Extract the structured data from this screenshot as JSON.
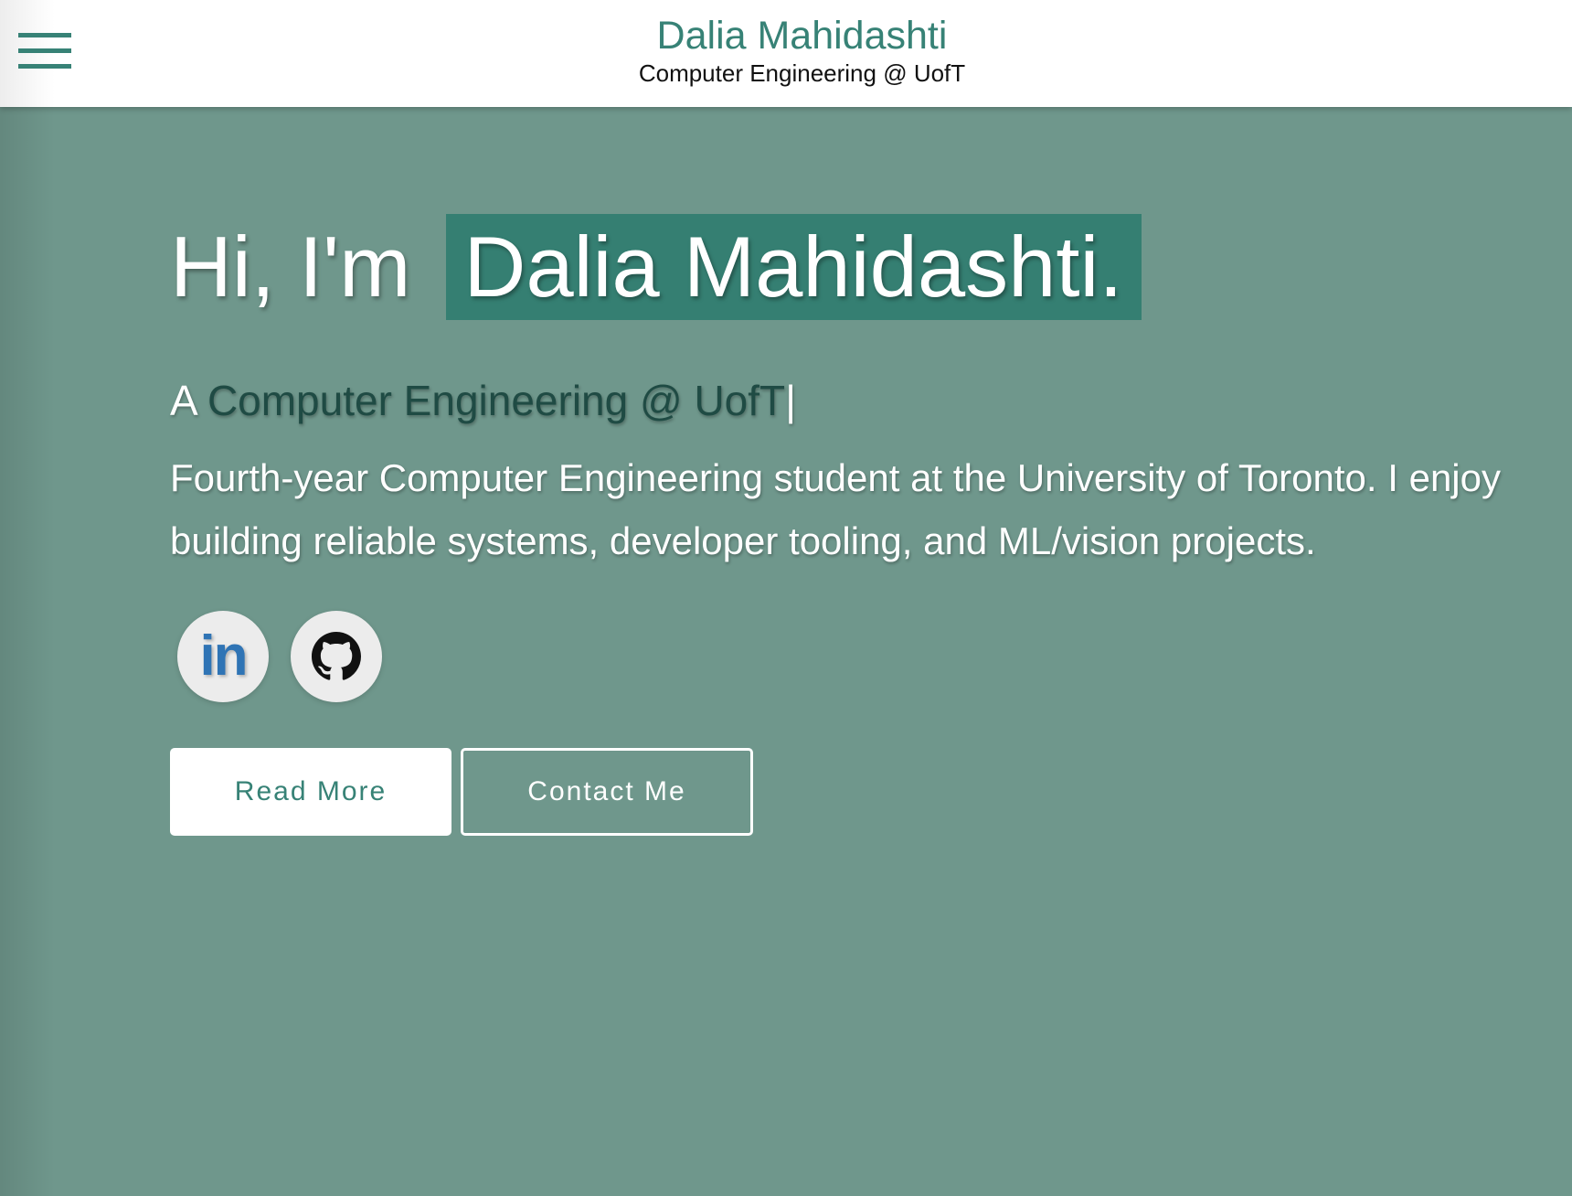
{
  "header": {
    "title": "Dalia Mahidashti",
    "subtitle": "Computer Engineering @ UofT",
    "menu_icon": "hamburger-menu-icon"
  },
  "hero": {
    "greeting_prefix": "Hi, I'm",
    "name": "Dalia Mahidashti.",
    "tagline_prefix": "A",
    "tagline_typed": "Computer Engineering @ UofT",
    "tagline_cursor": "|",
    "bio": "Fourth-year Computer Engineering student at the University of Toronto. I enjoy building reliable systems, developer tooling, and ML/vision projects."
  },
  "socials": [
    {
      "icon": "linkedin-icon",
      "glyph": "in"
    },
    {
      "icon": "github-icon"
    }
  ],
  "buttons": {
    "read_more": "Read More",
    "contact": "Contact Me"
  },
  "colors": {
    "accent": "#378276",
    "background": "#6f978c",
    "highlight": "#357f72",
    "tagline_typed": "#1f4b44"
  }
}
